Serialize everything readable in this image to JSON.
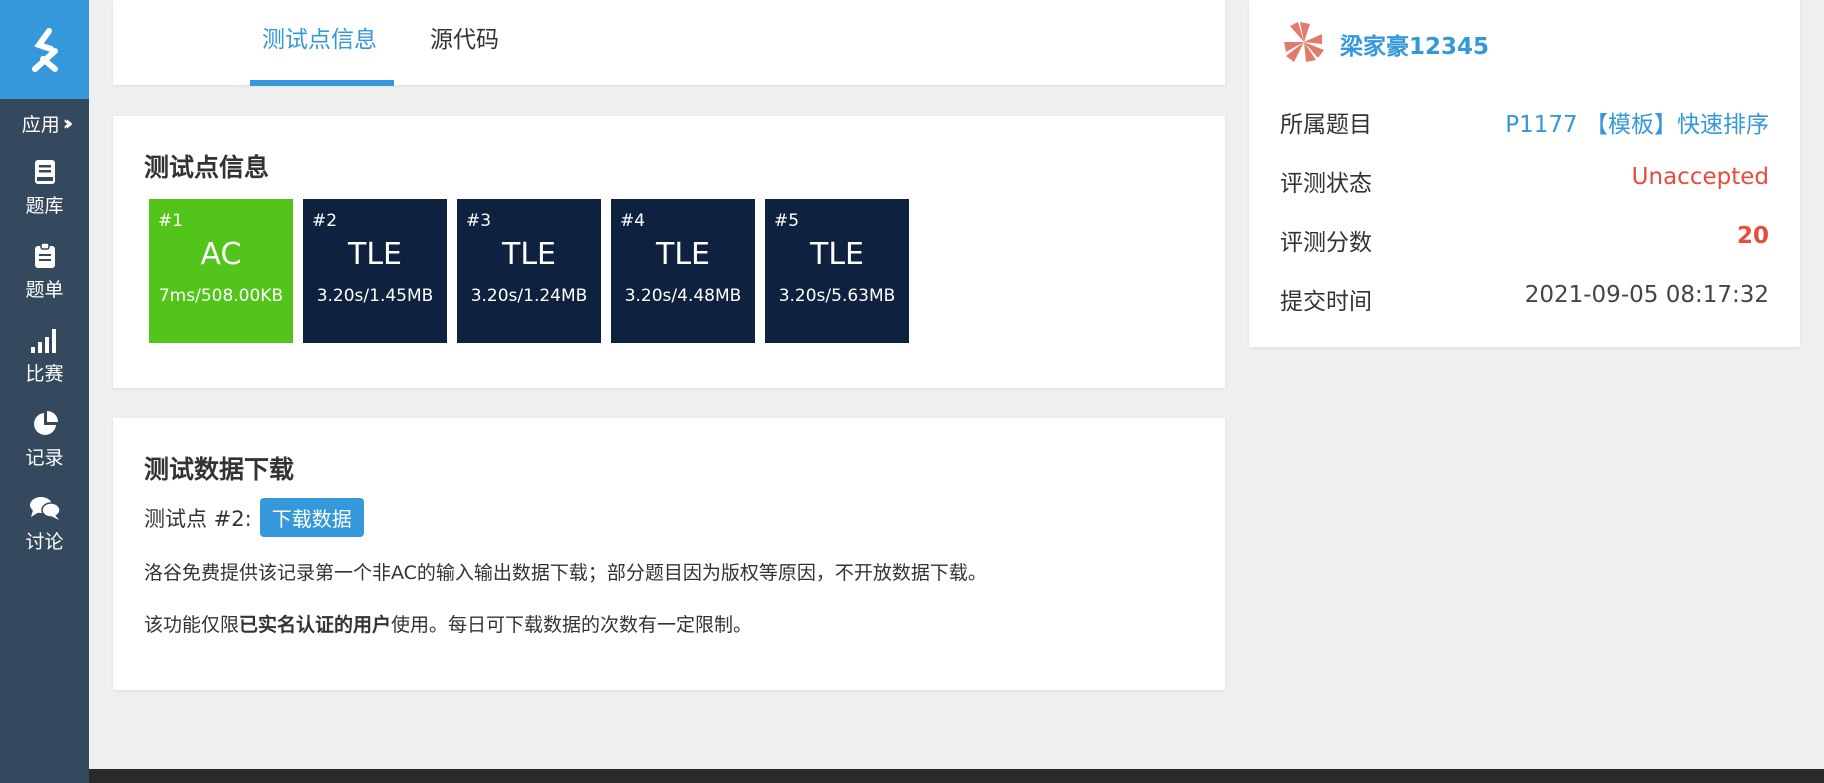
{
  "colors": {
    "brand": "#3498db",
    "sidebar": "#34495e",
    "ac": "#52c41a",
    "tle": "#0e2240",
    "unaccepted": "#e74c3c"
  },
  "sidebar": {
    "apps_label": "应用",
    "items": [
      {
        "label": "题库",
        "icon": "book-icon"
      },
      {
        "label": "题单",
        "icon": "clipboard-icon"
      },
      {
        "label": "比赛",
        "icon": "signal-bars-icon"
      },
      {
        "label": "记录",
        "icon": "pie-chart-icon"
      },
      {
        "label": "讨论",
        "icon": "chat-bubbles-icon"
      }
    ]
  },
  "tabs": {
    "active": "测试点信息",
    "source": "源代码"
  },
  "tests": {
    "title": "测试点信息",
    "cases": [
      {
        "num": "#1",
        "status": "AC",
        "meta": "7ms/508.00KB",
        "color": "#52c41a"
      },
      {
        "num": "#2",
        "status": "TLE",
        "meta": "3.20s/1.45MB",
        "color": "#0e2240"
      },
      {
        "num": "#3",
        "status": "TLE",
        "meta": "3.20s/1.24MB",
        "color": "#0e2240"
      },
      {
        "num": "#4",
        "status": "TLE",
        "meta": "3.20s/4.48MB",
        "color": "#0e2240"
      },
      {
        "num": "#5",
        "status": "TLE",
        "meta": "3.20s/5.63MB",
        "color": "#0e2240"
      }
    ]
  },
  "download": {
    "title": "测试数据下载",
    "label": "测试点 #2:",
    "button": "下载数据",
    "p1": "洛谷免费提供该记录第一个非AC的输入输出数据下载；部分题目因为版权等原因，不开放数据下载。",
    "p2_prefix": "该功能仅限",
    "p2_bold": "已实名认证的用户",
    "p2_suffix": "使用。每日可下载数据的次数有一定限制。"
  },
  "info": {
    "user": "梁家豪12345",
    "problem_key": "所属题目",
    "problem_value": "P1177 【模板】快速排序",
    "status_key": "评测状态",
    "status_value": "Unaccepted",
    "score_key": "评测分数",
    "score_value": "20",
    "time_key": "提交时间",
    "time_value": "2021-09-05 08:17:32"
  }
}
